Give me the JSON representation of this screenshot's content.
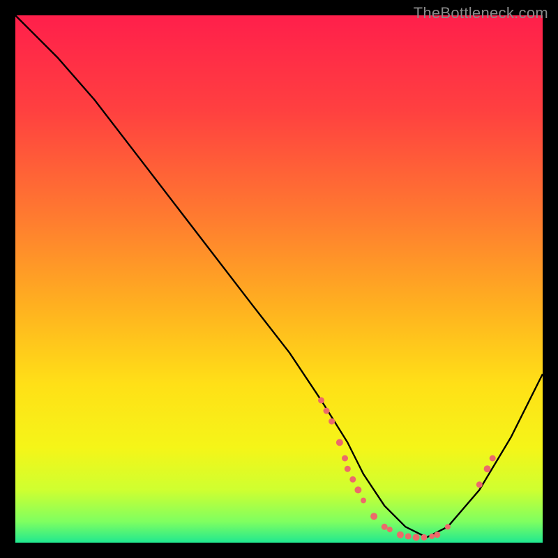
{
  "watermark": "TheBottleneck.com",
  "chart_data": {
    "type": "line",
    "title": "",
    "xlabel": "",
    "ylabel": "",
    "xlim": [
      0,
      100
    ],
    "ylim": [
      0,
      100
    ],
    "gradient_stops": [
      {
        "offset": 0,
        "color": "#ff1f4b"
      },
      {
        "offset": 18,
        "color": "#ff4040"
      },
      {
        "offset": 38,
        "color": "#ff7a30"
      },
      {
        "offset": 55,
        "color": "#ffb020"
      },
      {
        "offset": 70,
        "color": "#ffe017"
      },
      {
        "offset": 82,
        "color": "#f5f518"
      },
      {
        "offset": 90,
        "color": "#cfff30"
      },
      {
        "offset": 96,
        "color": "#7fff60"
      },
      {
        "offset": 100,
        "color": "#20e890"
      }
    ],
    "series": [
      {
        "name": "bottleneck-curve",
        "x": [
          0,
          3,
          8,
          15,
          25,
          35,
          45,
          52,
          58,
          63,
          66,
          70,
          74,
          78,
          82,
          88,
          94,
          100
        ],
        "y": [
          100,
          97,
          92,
          84,
          71,
          58,
          45,
          36,
          27,
          19,
          13,
          7,
          3,
          1,
          3,
          10,
          20,
          32
        ]
      }
    ],
    "markers": [
      {
        "x": 58,
        "y": 27,
        "r": 4.5
      },
      {
        "x": 59,
        "y": 25,
        "r": 4.5
      },
      {
        "x": 60,
        "y": 23,
        "r": 4.5
      },
      {
        "x": 61.5,
        "y": 19,
        "r": 5.0
      },
      {
        "x": 62.5,
        "y": 16,
        "r": 4.5
      },
      {
        "x": 63,
        "y": 14,
        "r": 4.5
      },
      {
        "x": 64,
        "y": 12,
        "r": 4.5
      },
      {
        "x": 65,
        "y": 10,
        "r": 5.0
      },
      {
        "x": 66,
        "y": 8,
        "r": 4.0
      },
      {
        "x": 68,
        "y": 5,
        "r": 5.0
      },
      {
        "x": 70,
        "y": 3,
        "r": 4.5
      },
      {
        "x": 71,
        "y": 2.5,
        "r": 4.0
      },
      {
        "x": 73,
        "y": 1.5,
        "r": 5.0
      },
      {
        "x": 74.5,
        "y": 1.2,
        "r": 4.5
      },
      {
        "x": 76,
        "y": 1.0,
        "r": 5.0
      },
      {
        "x": 77.5,
        "y": 1.0,
        "r": 4.5
      },
      {
        "x": 79,
        "y": 1.2,
        "r": 4.0
      },
      {
        "x": 80,
        "y": 1.5,
        "r": 4.5
      },
      {
        "x": 82,
        "y": 3,
        "r": 4.0
      },
      {
        "x": 88,
        "y": 11,
        "r": 4.5
      },
      {
        "x": 89.5,
        "y": 14,
        "r": 5.0
      },
      {
        "x": 90.5,
        "y": 16,
        "r": 4.5
      }
    ],
    "marker_color": "#ec6a6a"
  }
}
